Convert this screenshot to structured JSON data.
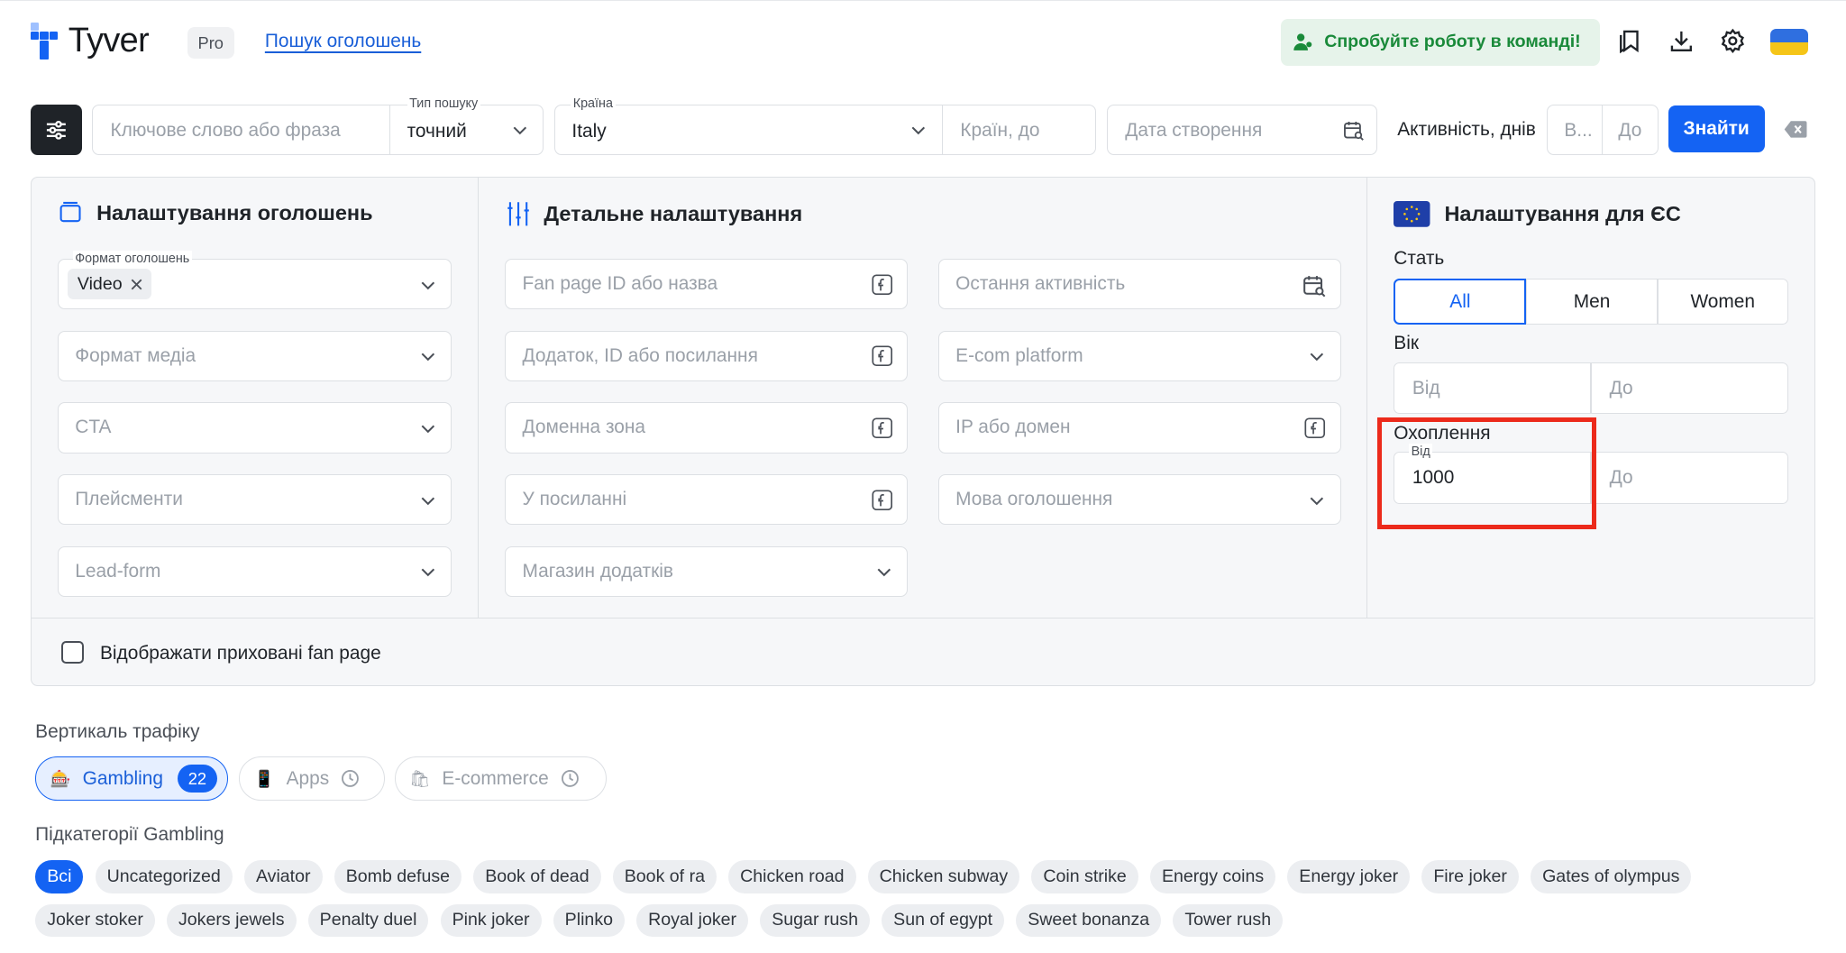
{
  "header": {
    "brand": "Tyver",
    "plan_badge": "Pro",
    "nav_link": "Пошук оголошень",
    "team_button": "Спробуйте роботу в команді!",
    "icons": [
      "bookmark-icon",
      "download-icon",
      "gear-icon",
      "ukraine-flag-icon"
    ]
  },
  "search": {
    "keyword_placeholder": "Ключове слово або фраза",
    "search_type_label": "Тип пошуку",
    "search_type_value": "точний",
    "country_label": "Країна",
    "country_value": "Italy",
    "countries_to_placeholder": "Країн, до",
    "created_date_placeholder": "Дата створення",
    "activity_label": "Активність, днів",
    "activity_from_placeholder": "В...",
    "activity_to_placeholder": "До",
    "find_button": "Знайти"
  },
  "ad_settings": {
    "title": "Налаштування оголошень",
    "format_label": "Формат оголошень",
    "format_chip": "Video",
    "media_format_placeholder": "Формат медіа",
    "cta_placeholder": "CTA",
    "placements_placeholder": "Плейсменти",
    "lead_form_placeholder": "Lead-form"
  },
  "detail_settings": {
    "title": "Детальне налаштування",
    "left": [
      "Fan page ID або назва",
      "Додаток, ID або посилання",
      "Доменна зона",
      "У посиланні",
      "Магазин додатків"
    ],
    "right": [
      "Остання активність",
      "E-com platform",
      "IP або домен",
      "Мова оголошення"
    ]
  },
  "eu_settings": {
    "title": "Налаштування для ЄС",
    "gender_label": "Стать",
    "gender_options": [
      "All",
      "Men",
      "Women"
    ],
    "gender_selected": "All",
    "age_label": "Вік",
    "age_from_placeholder": "Від",
    "age_to_placeholder": "До",
    "reach_label": "Охоплення",
    "reach_from_label": "Від",
    "reach_from_value": "1000",
    "reach_to_placeholder": "До"
  },
  "hidden_fanpage_label": "Відображати приховані fan page",
  "traffic": {
    "heading": "Вертикаль трафіку",
    "verticals": [
      {
        "label": "Gambling",
        "count": "22",
        "emoji": "🎰"
      },
      {
        "label": "Apps",
        "emoji": "📱"
      },
      {
        "label": "E-commerce",
        "emoji": "🛍"
      }
    ]
  },
  "subcategories": {
    "heading": "Підкатегорії Gambling",
    "items": [
      "Всі",
      "Uncategorized",
      "Aviator",
      "Bomb defuse",
      "Book of dead",
      "Book of ra",
      "Chicken road",
      "Chicken subway",
      "Coin strike",
      "Energy coins",
      "Energy joker",
      "Fire joker",
      "Gates of olympus",
      "Joker stoker",
      "Jokers jewels",
      "Penalty duel",
      "Pink joker",
      "Plinko",
      "Royal joker",
      "Sugar rush",
      "Sun of egypt",
      "Sweet bonanza",
      "Tower rush"
    ]
  },
  "colors": {
    "accent": "#1463f3",
    "highlight": "#ec2a1b",
    "success": "#1a8a3a"
  }
}
